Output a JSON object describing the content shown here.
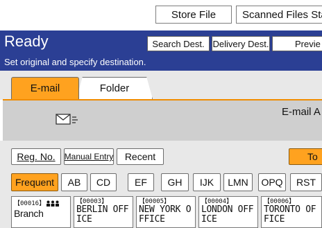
{
  "top_bar": {
    "store_file": "Store File",
    "scanned_files_status": "Scanned Files Sta"
  },
  "header": {
    "status": "Ready",
    "instruction": "Set original and specify destination.",
    "search_dest": "Search Dest.",
    "delivery_dest": "Delivery Dest.",
    "preview": "Previe"
  },
  "tabs": {
    "email": "E-mail",
    "folder": "Folder"
  },
  "destination": {
    "email_label": "E-mail A"
  },
  "actions": {
    "reg_no": "Reg. No.",
    "manual_entry": "Manual Entry",
    "recent": "Recent",
    "to": "To"
  },
  "index_keys": [
    "Frequent",
    "AB",
    "CD",
    "EF",
    "GH",
    "IJK",
    "LMN",
    "OPQ",
    "RST"
  ],
  "entries": [
    {
      "number": "【00016】",
      "name": "Branch",
      "group": true
    },
    {
      "number": "【00003】",
      "name": "BERLIN OFFICE",
      "group": false
    },
    {
      "number": "【00005】",
      "name": "NEW YORK OFFICE",
      "group": false
    },
    {
      "number": "【00004】",
      "name": "LONDON OFFICE",
      "group": false
    },
    {
      "number": "【00006】",
      "name": "TORONTO OFFICE",
      "group": false
    }
  ],
  "colors": {
    "header_bg": "#2b3f94",
    "accent": "#ffa21f"
  }
}
